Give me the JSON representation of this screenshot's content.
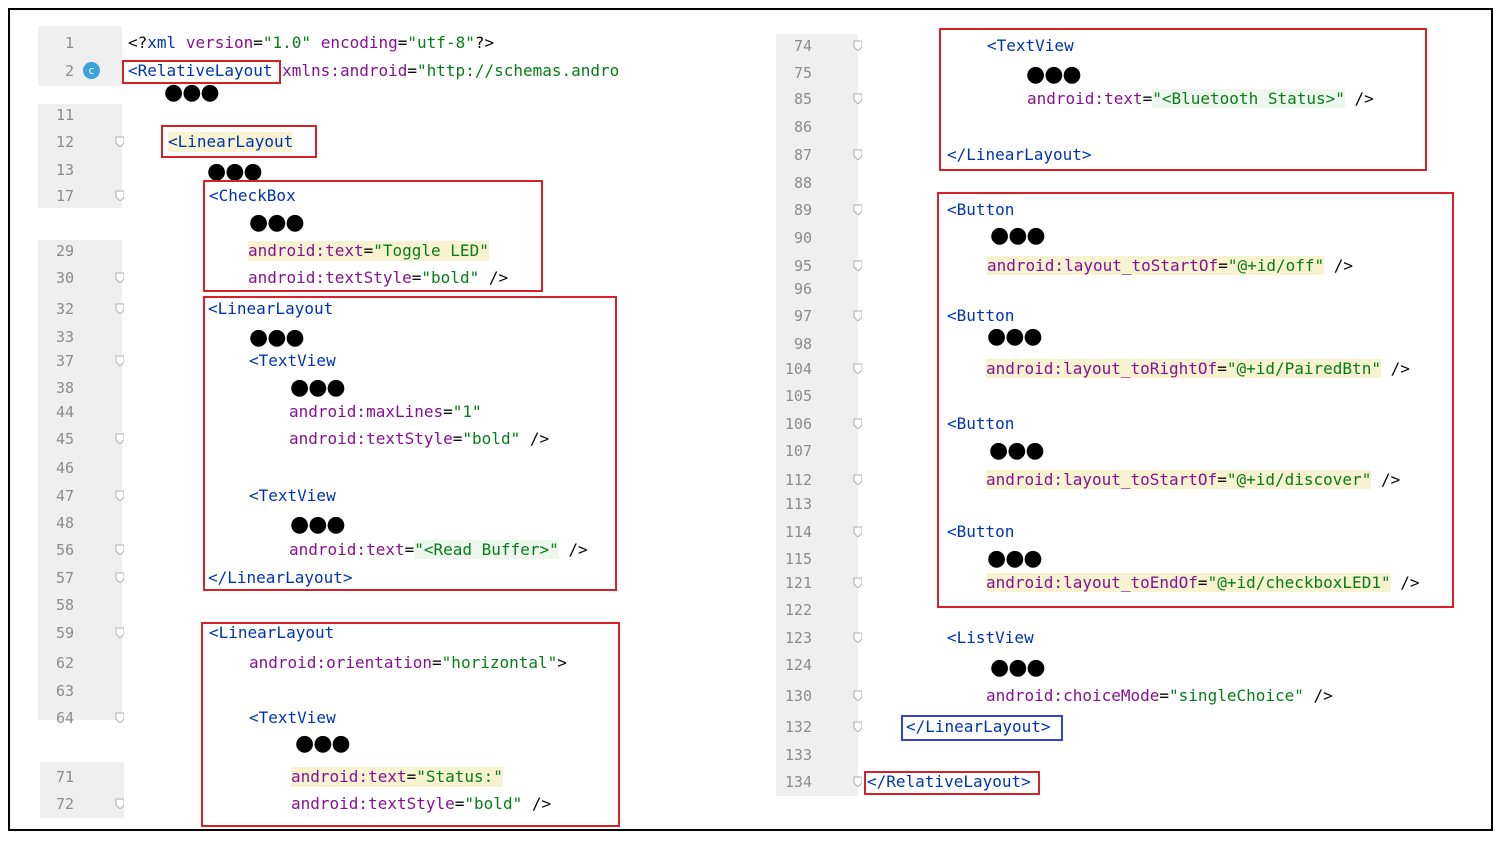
{
  "left_panel": {
    "line_numbers": [
      "1",
      "2",
      "11",
      "12",
      "13",
      "17",
      "29",
      "30",
      "32",
      "33",
      "37",
      "38",
      "44",
      "45",
      "46",
      "47",
      "48",
      "56",
      "57",
      "58",
      "59",
      "62",
      "63",
      "64",
      "71",
      "72"
    ],
    "code": {
      "xml_decl": {
        "open": "<?",
        "name": "xml",
        "a1": "version",
        "v1": "\"1.0\"",
        "a2": "encoding",
        "v2": "\"utf-8\"",
        "close": "?>"
      },
      "relative_open": {
        "tag": "<RelativeLayout",
        "attr": "xmlns:android",
        "val": "\"http://schemas.andro"
      },
      "linear_open": "<LinearLayout",
      "checkbox_open": "<CheckBox",
      "checkbox_text": {
        "attr": "android:text",
        "val": "\"Toggle LED\""
      },
      "checkbox_style": {
        "attr": "android:textStyle",
        "val": "\"bold\"",
        "close": "/>"
      },
      "linear2_open": "<LinearLayout",
      "textview1_open": "<TextView",
      "textview1_maxlines": {
        "attr": "android:maxLines",
        "val": "\"1\""
      },
      "textview1_style": {
        "attr": "android:textStyle",
        "val": "\"bold\"",
        "close": "/>"
      },
      "textview2_open": "<TextView",
      "textview2_text": {
        "attr": "android:text",
        "val": "\"<Read Buffer>\"",
        "close": "/>"
      },
      "linear2_close": "</LinearLayout>",
      "linear3_open": "<LinearLayout",
      "linear3_orient": {
        "attr": "android:orientation",
        "val": "\"horizontal\"",
        "close": ">"
      },
      "textview3_open": "<TextView",
      "textview3_text": {
        "attr": "android:text",
        "val": "\"Status:\""
      },
      "textview3_style": {
        "attr": "android:textStyle",
        "val": "\"bold\"",
        "close": "/>"
      }
    },
    "ellipsis": "●●●"
  },
  "right_panel": {
    "line_numbers": [
      "74",
      "75",
      "85",
      "86",
      "87",
      "88",
      "89",
      "90",
      "95",
      "96",
      "97",
      "98",
      "104",
      "105",
      "106",
      "107",
      "112",
      "113",
      "114",
      "115",
      "121",
      "122",
      "123",
      "124",
      "130",
      "132",
      "133",
      "134"
    ],
    "code": {
      "textview_open": "<TextView",
      "textview_text": {
        "attr": "android:text",
        "val": "\"<Bluetooth Status>\"",
        "close": "/>"
      },
      "linear_close": "</LinearLayout>",
      "button1_open": "<Button",
      "button1_attr": {
        "attr": "android:layout_toStartOf",
        "val": "\"@+id/off\"",
        "close": "/>"
      },
      "button2_open": "<Button",
      "button2_attr": {
        "attr": "android:layout_toRightOf",
        "val": "\"@+id/PairedBtn\"",
        "close": "/>"
      },
      "button3_open": "<Button",
      "button3_attr": {
        "attr": "android:layout_toStartOf",
        "val": "\"@+id/discover\"",
        "close": "/>"
      },
      "button4_open": "<Button",
      "button4_attr": {
        "attr": "android:layout_toEndOf",
        "val": "\"@+id/checkboxLED1\"",
        "close": "/>"
      },
      "listview_open": "<ListView",
      "listview_attr": {
        "attr": "android:choiceMode",
        "val": "\"singleChoice\"",
        "close": "/>"
      },
      "outer_linear_close": "</LinearLayout>",
      "relative_close": "</RelativeLayout>"
    },
    "ellipsis": "●●●"
  },
  "badge": "c",
  "colors": {
    "highlight_box": "#d7212a",
    "outer_linear_box": "#3048b8",
    "tag": "#0033b3",
    "attribute": "#871094",
    "value": "#067d17"
  }
}
